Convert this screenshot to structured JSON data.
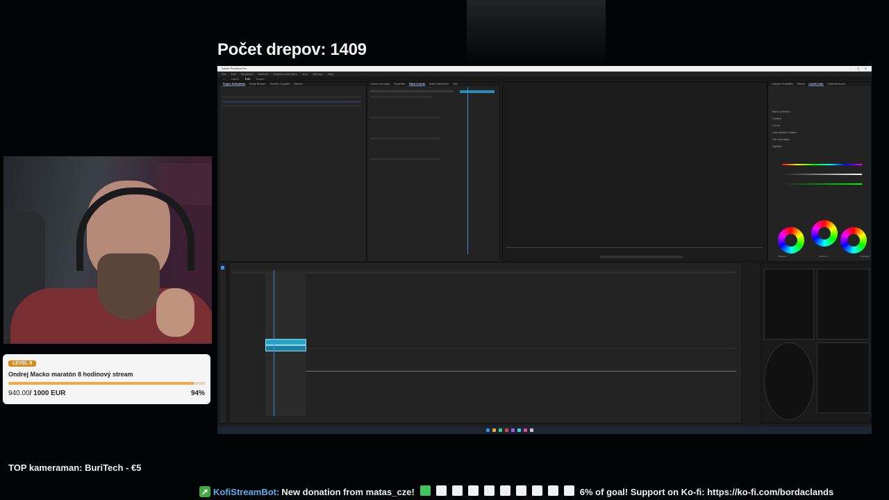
{
  "overlay": {
    "counter": "Počet drepov: 1409",
    "goal": {
      "level": "LEVEL 9",
      "title": "Ondrej Macko maratón 8 hodinový stream",
      "current": "940.00",
      "target": "/ 1000 EUR",
      "percent": "94%",
      "progress_fraction": 0.94,
      "accent_color": "#efa84a"
    },
    "top_cameraman": "TOP kameraman: BuriTech - €5",
    "ticker": {
      "icon": "rocket-icon",
      "bot_name": "KofiStreamBot:",
      "message": "New donation from matas_cze!",
      "filled_squares": 1,
      "total_squares": 10,
      "goal_text": "6% of goal! Support on Ko-fi: https://ko-fi.com/bordaclands",
      "bot_color": "#5fb0f0"
    }
  },
  "premiere": {
    "menu": [
      "File",
      "Edit",
      "Sequence",
      "Markers",
      "Graphics and Titles",
      "View",
      "Window",
      "Help"
    ],
    "workspaces": [
      "Import",
      "Edit",
      "Export"
    ],
    "project_tabs": [
      "Project: Snehulienka",
      "Media Browser",
      "Timeline Complete",
      "Markers"
    ],
    "effect_tabs": [
      "Source: (no clips)",
      "Properties",
      "Effect Controls",
      "Audio Track Mixer",
      "Text"
    ],
    "right_tabs": [
      "Graphics Templates",
      "Effects",
      "Lumetri Color",
      "Essential Sound"
    ],
    "lumetri_sections": [
      "Basic Correction",
      "Creative",
      "Curves",
      "Color Wheels & Match",
      "HSL Secondary",
      "Vignette"
    ],
    "wheel_labels": [
      "Shadows",
      "Midtones",
      "Highlights"
    ]
  }
}
